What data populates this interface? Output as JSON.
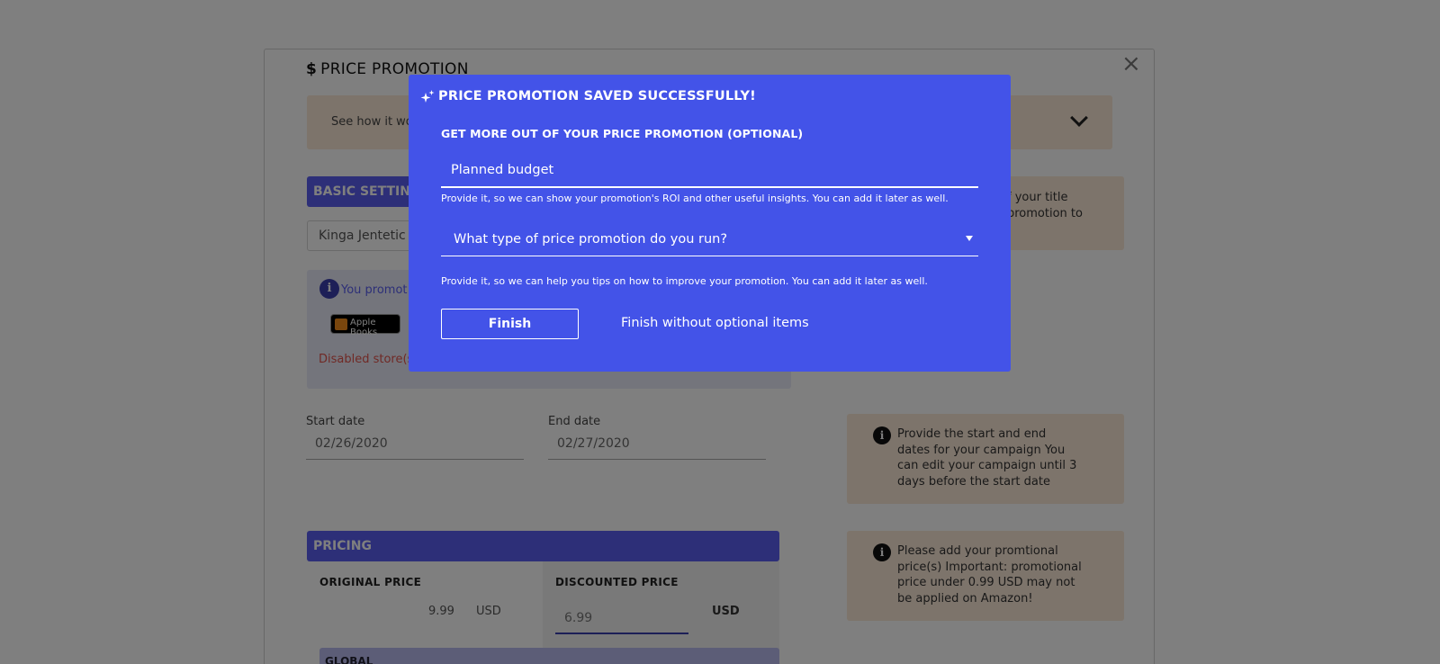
{
  "background": {
    "dialog_title": "PRICE PROMOTION",
    "dollar_symbol": "$",
    "close_glyph": "×",
    "banner_text": "See how it wo",
    "basic_settings_label": "BASIC SETTING",
    "title_select_value": "Kinga Jentetic",
    "store_info_text": "You promot",
    "apple_books_badge": "Apple Books",
    "disabled_stores_text": "Disabled store(s",
    "tip_title": "f your title\npromotion to",
    "start_date_label": "Start date",
    "start_date_value": "02/26/2020",
    "end_date_label": "End date",
    "end_date_value": "02/27/2020",
    "tip_dates": "Provide the start and end dates for your campaign You can edit your campaign until 3 days before the start date",
    "pricing_label": "PRICING",
    "original_price_label": "ORIGINAL PRICE",
    "original_price_value": "9.99",
    "original_currency": "USD",
    "discounted_price_label": "DISCOUNTED PRICE",
    "discounted_price_value": "6.99",
    "discounted_currency": "USD",
    "global_label": "GLOBAL",
    "tip_pricing": "Please add your promtional price(s) Important: promotional price under 0.99 USD may not be applied on Amazon!",
    "info_glyph": "i"
  },
  "modal": {
    "title": "PRICE PROMOTION SAVED SUCCESSFULLY!",
    "subtitle": "GET MORE OUT OF YOUR PRICE PROMOTION (OPTIONAL)",
    "budget_placeholder": "Planned budget",
    "budget_helper": "Provide it, so we can show your promotion's ROI and other useful insights. You can add it later as well.",
    "type_select_placeholder": "What type of price promotion do you run?",
    "type_helper": "Provide it, so we can help you tips on how to improve your promotion. You can add it later as well.",
    "finish_label": "Finish",
    "skip_label": "Finish without optional items"
  },
  "colors": {
    "modal_bg": "#4353e8",
    "section_bar": "#5a5ff0",
    "tip_bg": "#fbe8d6",
    "overlay": "rgba(0,0,0,0.5)"
  }
}
